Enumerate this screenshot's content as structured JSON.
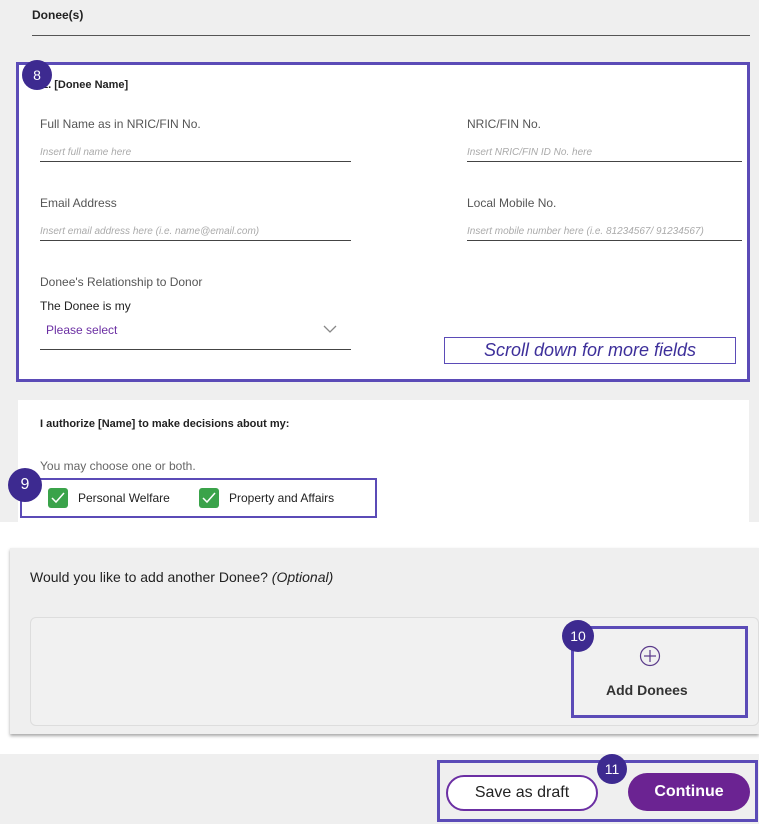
{
  "section": {
    "title": "Donee(s)"
  },
  "donee": {
    "heading": "1. [Donee Name]",
    "full_name": {
      "label": "Full Name as in NRIC/FIN No.",
      "placeholder": "Insert full name here"
    },
    "nric": {
      "label": "NRIC/FIN No.",
      "placeholder": "Insert NRIC/FIN ID No. here"
    },
    "email": {
      "label": "Email Address",
      "placeholder": "Insert email address here (i.e. name@email.com)"
    },
    "mobile": {
      "label": "Local Mobile No.",
      "placeholder": "Insert mobile number here (i.e. 81234567/ 91234567)"
    },
    "relationship": {
      "label": "Donee's Relationship to Donor",
      "sublabel": "The Donee is my",
      "value": "Please select"
    },
    "scroll_note": "Scroll down for more fields"
  },
  "authorize": {
    "heading": "I authorize [Name] to make decisions about my:",
    "hint": "You may choose one or both.",
    "options": [
      {
        "label": "Personal Welfare",
        "checked": true
      },
      {
        "label": "Property and Affairs",
        "checked": true
      }
    ]
  },
  "add_donee": {
    "question": "Would you like to add another Donee?",
    "optional": "(Optional)",
    "button_label": "Add Donees"
  },
  "actions": {
    "draft_label": "Save as draft",
    "continue_label": "Continue"
  },
  "annotations": {
    "badge_8": "8",
    "badge_9": "9",
    "badge_10": "10",
    "badge_11": "11"
  },
  "colors": {
    "accent": "#6b2392",
    "highlight": "#5b4bb7",
    "checkbox": "#3aa34a"
  }
}
